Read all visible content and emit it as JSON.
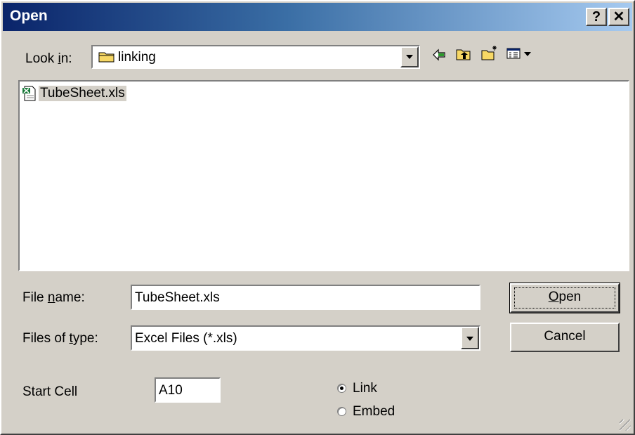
{
  "window": {
    "title": "Open",
    "help_glyph": "?",
    "close_glyph": "✕"
  },
  "look_in": {
    "label_pre": "Look ",
    "label_accel": "i",
    "label_post": "n:",
    "value": "linking"
  },
  "toolbar": {
    "icons": [
      "back-icon",
      "up-folder-icon",
      "new-folder-icon",
      "view-menu-icon"
    ]
  },
  "files": [
    {
      "name": "TubeSheet.xls",
      "icon": "excel-file-icon"
    }
  ],
  "file_name": {
    "label_pre": "File ",
    "label_accel": "n",
    "label_post": "ame:",
    "value": "TubeSheet.xls"
  },
  "file_type": {
    "label_pre": "Files of ",
    "label_accel": "t",
    "label_post": "ype:",
    "value": "Excel Files (*.xls)"
  },
  "start_cell": {
    "label": "Start Cell",
    "value": "A10"
  },
  "mode": {
    "options": [
      {
        "label": "Link",
        "selected": true
      },
      {
        "label": "Embed",
        "selected": false
      }
    ]
  },
  "buttons": {
    "open_accel": "O",
    "open_rest": "pen",
    "cancel": "Cancel"
  },
  "colors": {
    "title_gradient_start": "#0a246a",
    "title_gradient_end": "#a6caf0",
    "dialog_face": "#d4d0c8",
    "selection_bg": "#d4d0c8"
  }
}
